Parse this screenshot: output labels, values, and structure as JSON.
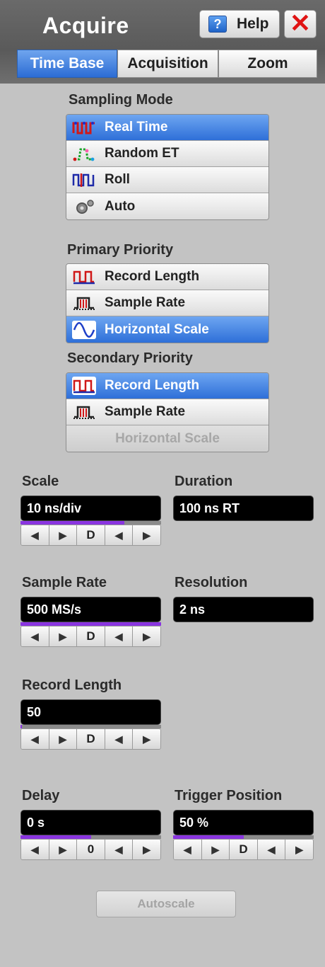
{
  "header": {
    "title": "Acquire",
    "help_label": "Help",
    "help_icon_glyph": "?",
    "close_glyph": "✕"
  },
  "tabs": [
    {
      "label": "Time Base",
      "active": true
    },
    {
      "label": "Acquisition",
      "active": false
    },
    {
      "label": "Zoom",
      "active": false
    }
  ],
  "sampling_mode": {
    "label": "Sampling Mode",
    "options": [
      {
        "label": "Real Time",
        "icon": "real-time-waveform-icon",
        "selected": true
      },
      {
        "label": "Random ET",
        "icon": "random-et-waveform-icon",
        "selected": false
      },
      {
        "label": "Roll",
        "icon": "roll-waveform-icon",
        "selected": false
      },
      {
        "label": "Auto",
        "icon": "auto-gear-icon",
        "selected": false
      }
    ]
  },
  "primary_priority": {
    "label": "Primary Priority",
    "options": [
      {
        "label": "Record Length",
        "icon": "record-length-icon",
        "selected": false
      },
      {
        "label": "Sample Rate",
        "icon": "sample-rate-icon",
        "selected": false
      },
      {
        "label": "Horizontal Scale",
        "icon": "sine-wave-icon",
        "selected": true
      }
    ]
  },
  "secondary_priority": {
    "label": "Secondary Priority",
    "options": [
      {
        "label": "Record Length",
        "icon": "record-length-icon",
        "selected": true
      },
      {
        "label": "Sample Rate",
        "icon": "sample-rate-icon",
        "selected": false
      },
      {
        "label": "Horizontal Scale",
        "icon": "",
        "selected": false,
        "disabled": true
      }
    ]
  },
  "controls": {
    "scale": {
      "label": "Scale",
      "value": "10 ns/div",
      "level": 0.74,
      "middle_button": "D"
    },
    "duration": {
      "label": "Duration",
      "value": "100 ns  RT"
    },
    "sample_rate": {
      "label": "Sample Rate",
      "value": "500 MS/s",
      "level": 1.0,
      "middle_button": "D"
    },
    "resolution": {
      "label": "Resolution",
      "value": "2 ns"
    },
    "record_length": {
      "label": "Record Length",
      "value": "50",
      "level": 0.01,
      "middle_button": "D"
    },
    "delay": {
      "label": "Delay",
      "value": "0 s",
      "level": 0.5,
      "middle_button": "0"
    },
    "trigger_position": {
      "label": "Trigger Position",
      "value": "50 %",
      "level": 0.5,
      "middle_button": "D"
    }
  },
  "stepper_glyphs": {
    "left": "◀",
    "right": "▶"
  },
  "autoscale_label": "Autoscale",
  "colors": {
    "accent_blue": "#2e6fd8",
    "bar_purple": "#8a35e0",
    "close_red": "#e01414"
  }
}
